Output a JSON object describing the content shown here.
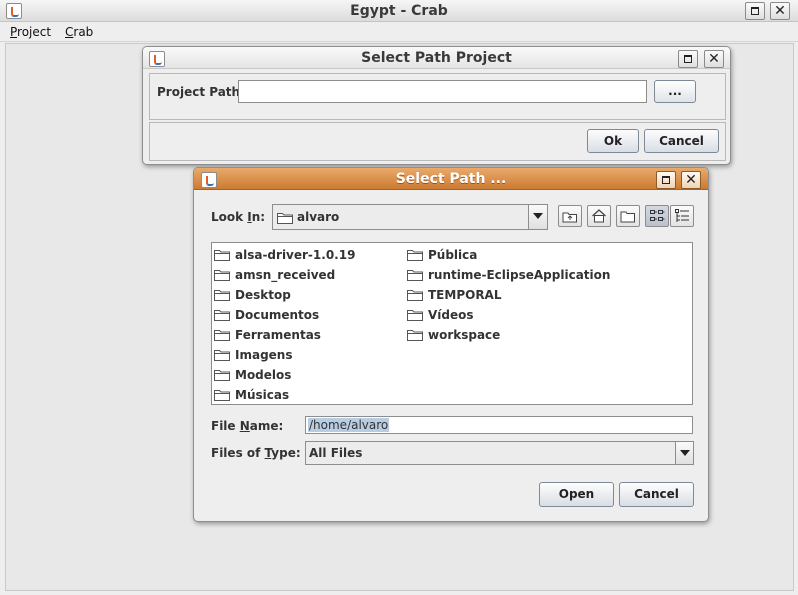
{
  "main_window": {
    "title": "Egypt - Crab",
    "menu": [
      {
        "first": "P",
        "rest": "roject"
      },
      {
        "first": "C",
        "rest": "rab"
      }
    ]
  },
  "project_dialog": {
    "title": "Select Path Project",
    "path_label": "Project Path:",
    "path_value": "",
    "browse_label": "...",
    "ok_label": "Ok",
    "cancel_label": "Cancel"
  },
  "path_dialog": {
    "title": "Select Path ...",
    "look_in": {
      "pre": "Look ",
      "mn": "I",
      "post": "n:"
    },
    "look_in_value": "alvaro",
    "toolbar_icons": [
      "up-folder-icon",
      "home-icon",
      "new-folder-icon",
      "list-view-icon",
      "details-view-icon"
    ],
    "files_col1": [
      "alsa-driver-1.0.19",
      "amsn_received",
      "Desktop",
      "Documentos",
      "Ferramentas",
      "Imagens",
      "Modelos",
      "Músicas"
    ],
    "files_col2": [
      "Pública",
      "runtime-EclipseApplication",
      "TEMPORAL",
      "Vídeos",
      "workspace"
    ],
    "file_name": {
      "pre": "File ",
      "mn": "N",
      "post": "ame:"
    },
    "file_name_value": "/home/alvaro",
    "files_of_type": {
      "pre": "Files of ",
      "mn": "T",
      "post": "ype:"
    },
    "files_of_type_value": "All Files",
    "open_label": "Open",
    "cancel_label": "Cancel"
  },
  "colors": {
    "active_title": "#cc7a31",
    "background": "#eeeeee"
  }
}
